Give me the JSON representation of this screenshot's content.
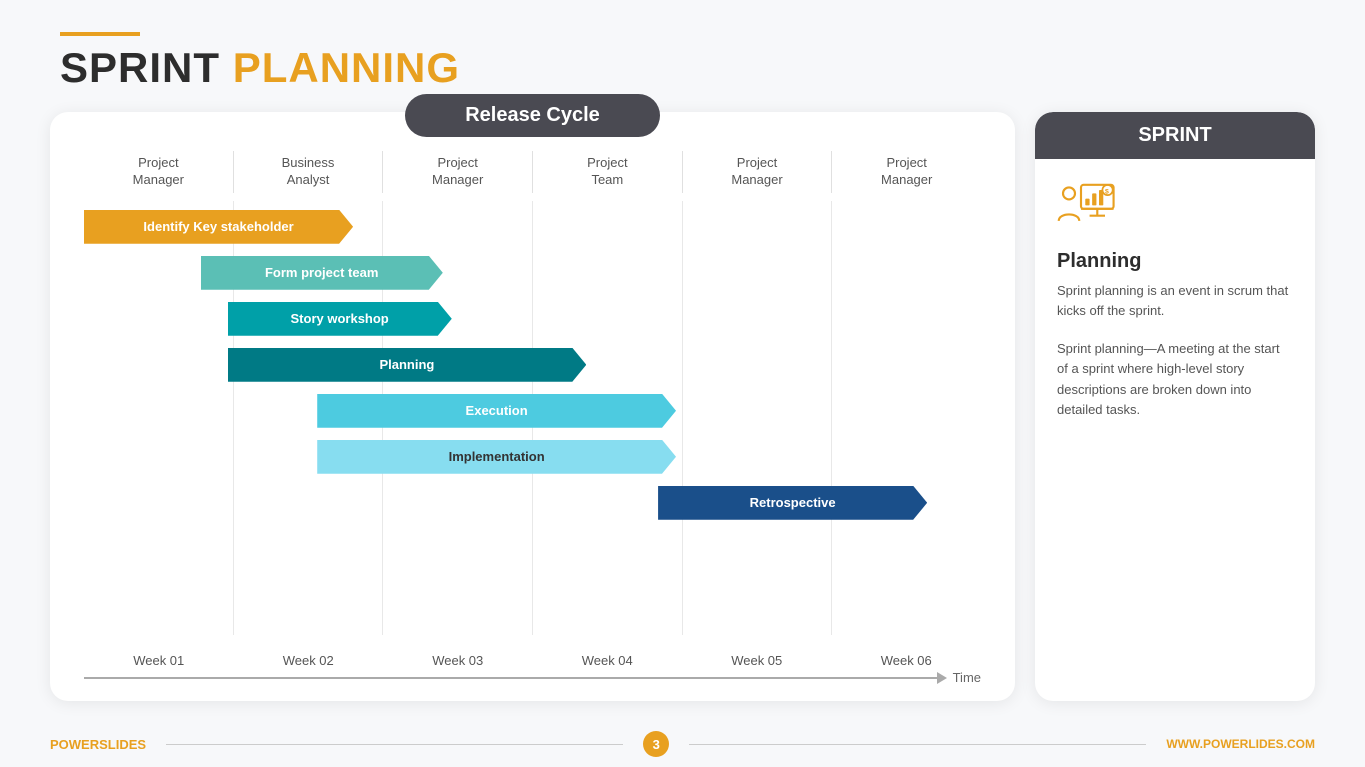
{
  "header": {
    "line_color": "#E8A020",
    "title_black": "SPRINT",
    "title_gold": "PLANNING"
  },
  "release_cycle": {
    "badge_label": "Release Cycle",
    "columns": [
      {
        "line1": "Project",
        "line2": "Manager"
      },
      {
        "line1": "Business",
        "line2": "Analyst"
      },
      {
        "line1": "Project",
        "line2": "Manager"
      },
      {
        "line1": "Project",
        "line2": "Team"
      },
      {
        "line1": "Project",
        "line2": "Manager"
      },
      {
        "line1": "Project",
        "line2": "Manager"
      }
    ],
    "bars": [
      {
        "label": "Identify Key stakeholder",
        "color": "#E8A020",
        "left": "0%",
        "width": "26%"
      },
      {
        "label": "Form project team",
        "color": "#5bbfb5",
        "left": "14%",
        "width": "24%"
      },
      {
        "label": "Story workshop",
        "color": "#00a0a8",
        "left": "16%",
        "width": "24%"
      },
      {
        "label": "Planning",
        "color": "#007a85",
        "left": "16%",
        "width": "36%"
      },
      {
        "label": "Execution",
        "color": "#4dcbe0",
        "left": "26%",
        "width": "36%"
      },
      {
        "label": "Implementation",
        "color": "#87ddf0",
        "left": "26%",
        "width": "36%"
      },
      {
        "label": "Retrospective",
        "color": "#1a4f8a",
        "left": "65%",
        "width": "28%"
      }
    ],
    "weeks": [
      "Week 01",
      "Week 02",
      "Week 03",
      "Week 04",
      "Week 05",
      "Week 06"
    ],
    "time_label": "Time"
  },
  "sprint_panel": {
    "badge_label": "SPRINT",
    "heading": "Planning",
    "text1": "Sprint planning is an event in scrum that kicks off the sprint.",
    "text2": "Sprint planning—A meeting at the start of a sprint where high-level story descriptions are broken down into detailed tasks."
  },
  "footer": {
    "brand_black": "POWER",
    "brand_gold": "SLIDES",
    "page_number": "3",
    "website": "WWW.POWERLIDES.COM"
  }
}
